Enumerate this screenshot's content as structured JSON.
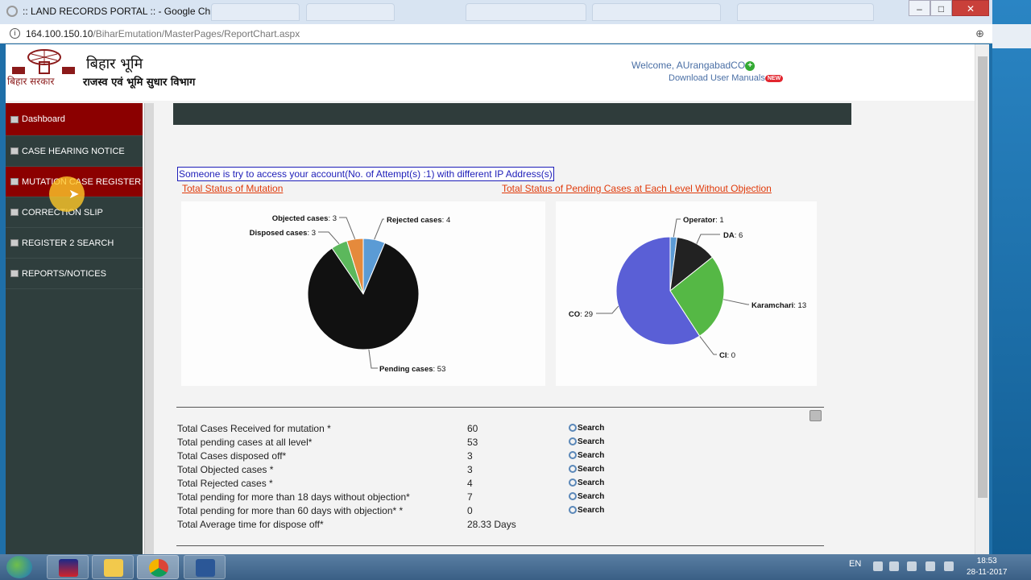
{
  "window": {
    "title": ":: LAND RECORDS PORTAL :: - Google Chrome",
    "url_host": "164.100.150.10",
    "url_path": "/BiharEmutation/MasterPages/ReportChart.aspx"
  },
  "header": {
    "logo_title": "बिहार भूमि",
    "logo_left_text": "बिहार सरकार",
    "department": "राजस्व एवं भूमि सुधार विभाग",
    "welcome": "Welcome, AUrangabadCO",
    "download_manuals": "Download User Manuals",
    "new_badge": "NEW"
  },
  "sidebar": {
    "items": [
      {
        "label": "Dashboard"
      },
      {
        "label": "CASE HEARING NOTICE"
      },
      {
        "label": "MUTATION CASE REGISTER"
      },
      {
        "label": "CORRECTION SLIP"
      },
      {
        "label": "REGISTER 2 SEARCH"
      },
      {
        "label": "REPORTS/NOTICES"
      }
    ]
  },
  "main": {
    "alert": "Someone is try to access your account(No. of Attempt(s) :1) with different IP Address(s)",
    "link_mutation": "Total Status of Mutation",
    "link_pending": "Total Status of Pending Cases at Each Level Without Objection"
  },
  "colors": {
    "sidebar_bg": "#2f3e3d",
    "sidebar_active": "#8b0000",
    "link_orange": "#e03a0a",
    "alert_blue": "#1d1db8"
  },
  "chart_data": [
    {
      "type": "pie",
      "categories": [
        "Rejected cases",
        "Pending cases",
        "Disposed cases",
        "Objected cases"
      ],
      "values": [
        4,
        53,
        3,
        3
      ],
      "colors": [
        "#5b9bd5",
        "#111111",
        "#5cb85c",
        "#e58a3c"
      ],
      "labels": [
        {
          "name": "Rejected cases",
          "value": "4"
        },
        {
          "name": "Pending cases",
          "value": "53"
        },
        {
          "name": "Disposed cases",
          "value": "3"
        },
        {
          "name": "Objected cases",
          "value": "3"
        }
      ]
    },
    {
      "type": "pie",
      "categories": [
        "Operator",
        "DA",
        "Karamchari",
        "CI",
        "CO"
      ],
      "values": [
        1,
        6,
        13,
        0,
        29
      ],
      "colors": [
        "#5b9bd5",
        "#222222",
        "#55b845",
        "#cccccc",
        "#5a5fd6"
      ],
      "labels": [
        {
          "name": "Operator",
          "value": "1"
        },
        {
          "name": "DA",
          "value": "6"
        },
        {
          "name": "Karamchari",
          "value": "13"
        },
        {
          "name": "CI",
          "value": "0"
        },
        {
          "name": "CO",
          "value": "29"
        }
      ]
    }
  ],
  "stats": [
    {
      "label": "Total Cases Received for mutation *",
      "value": "60",
      "action": "Search"
    },
    {
      "label": "Total pending cases at all level*",
      "value": "53",
      "action": "Search"
    },
    {
      "label": "Total Cases disposed off*",
      "value": "3",
      "action": "Search"
    },
    {
      "label": "Total Objected cases *",
      "value": "3",
      "action": "Search"
    },
    {
      "label": "Total Rejected cases *",
      "value": "4",
      "action": "Search"
    },
    {
      "label": "Total pending for more than 18 days without objection*",
      "value": "7",
      "action": "Search"
    },
    {
      "label": "Total pending for more than 60 days with objection*  *",
      "value": "0",
      "action": "Search"
    },
    {
      "label": "Total Average time for dispose off*",
      "value": "28.33 Days",
      "action": ""
    }
  ],
  "taskbar": {
    "lang": "EN",
    "time": "18:53",
    "date": "28-11-2017"
  }
}
